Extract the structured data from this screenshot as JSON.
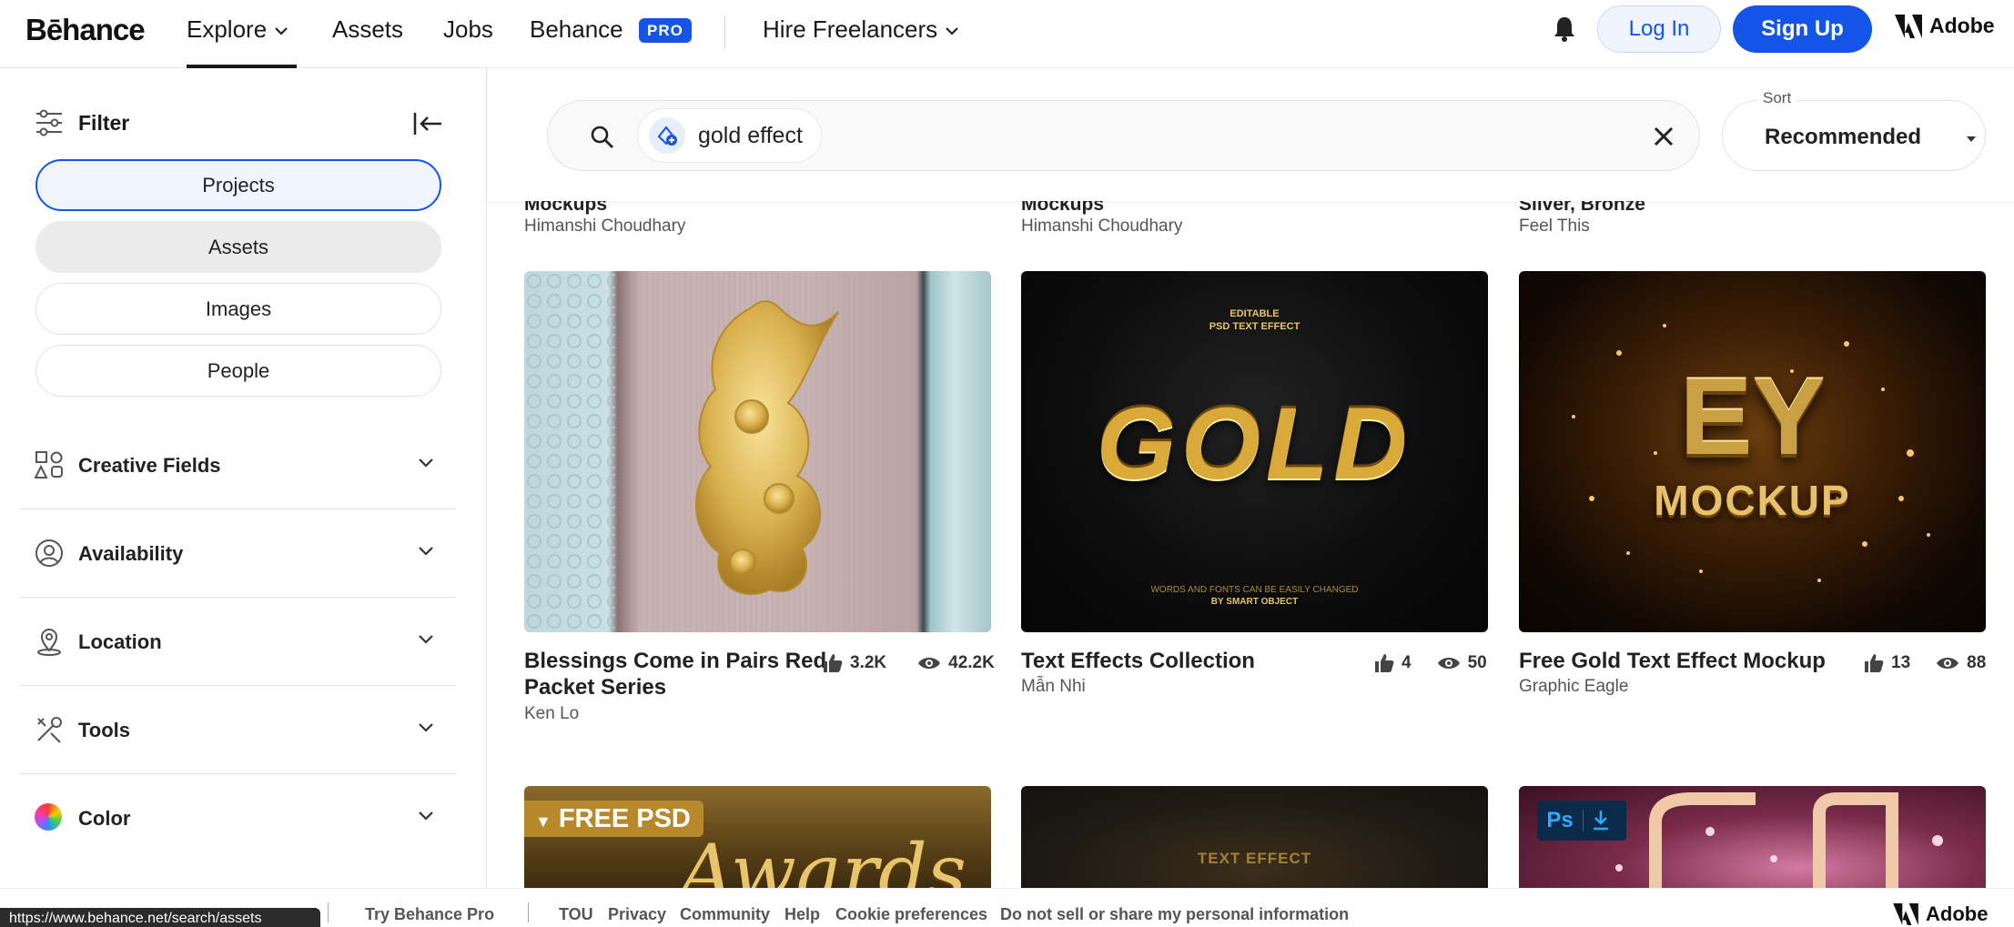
{
  "nav": {
    "logo": "Bēhance",
    "explore": "Explore",
    "assets": "Assets",
    "jobs": "Jobs",
    "behance": "Behance",
    "pro_badge": "PRO",
    "hire": "Hire Freelancers",
    "login": "Log In",
    "signup": "Sign Up",
    "adobe": "Adobe"
  },
  "sidebar": {
    "filter": "Filter",
    "pills": [
      "Projects",
      "Assets",
      "Images",
      "People"
    ],
    "sections": [
      "Creative Fields",
      "Availability",
      "Location",
      "Tools",
      "Color"
    ]
  },
  "search": {
    "query": "gold effect",
    "sort_label": "Sort",
    "sort_value": "Recommended"
  },
  "previous_row": [
    {
      "title": "Mockups",
      "owner": "Himanshi Choudhary"
    },
    {
      "title": "Mockups",
      "owner": "Himanshi Choudhary"
    },
    {
      "title": "Silver, Bronze",
      "owner": "Feel This"
    }
  ],
  "cards": [
    {
      "title": "Blessings Come in Pairs Red Packet Series",
      "title_line1": "Blessings Come in Pairs Red",
      "title_line2": "Packet Series",
      "owner": "Ken Lo",
      "likes": "3.2K",
      "views": "42.2K"
    },
    {
      "title": "Text Effects Collection",
      "owner": "Mẫn Nhi",
      "likes": "4",
      "views": "50",
      "img_top": "EDITABLE",
      "img_top2": "PSD TEXT EFFECT",
      "img_word": "GOLD",
      "img_bottom": "WORDS AND FONTS CAN BE EASILY CHANGED",
      "img_bottom2": "BY SMART OBJECT"
    },
    {
      "title": "Free Gold Text Effect Mockup",
      "owner": "Graphic Eagle",
      "likes": "13",
      "views": "88",
      "img_word": "EY",
      "img_word2": "MOCKUP"
    }
  ],
  "bottom_row": {
    "free_psd": "FREE PSD",
    "script": "Awards",
    "text_effect": "TEXT EFFECT",
    "ps": "Ps"
  },
  "footer": {
    "url": "https://www.behance.net/search/assets",
    "try_pro": "Try Behance Pro",
    "links": [
      "TOU",
      "Privacy",
      "Community",
      "Help",
      "Cookie preferences",
      "Do not sell or share my personal information"
    ],
    "adobe": "Adobe"
  },
  "colors": {
    "brand_blue": "#1455e8",
    "gold": "#d4a93a",
    "text": "#191919"
  }
}
